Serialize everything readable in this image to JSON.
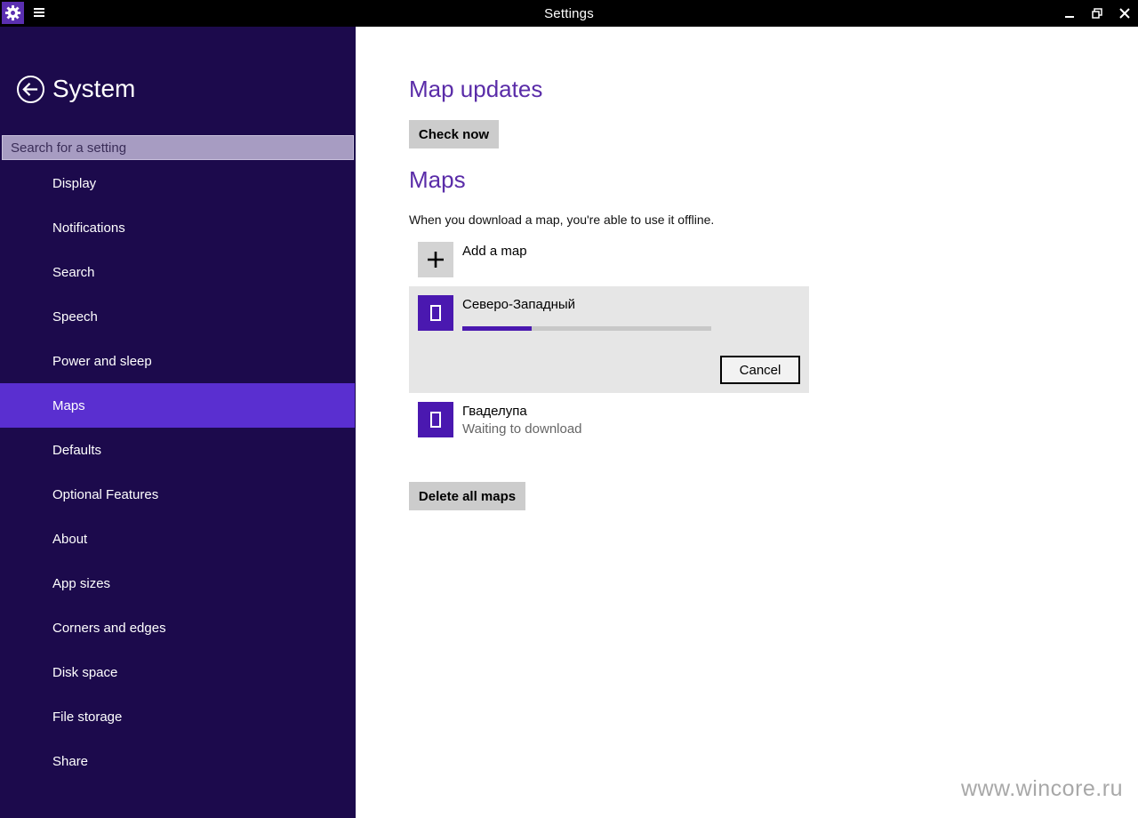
{
  "titlebar": {
    "title": "Settings",
    "icons": {
      "app": "gear-icon",
      "menu": "hamburger-icon",
      "minimize": "minimize-icon",
      "restore": "restore-icon",
      "close": "close-icon"
    }
  },
  "sidebar": {
    "title": "System",
    "back_icon": "back-arrow-icon",
    "search": {
      "placeholder": "Search for a setting",
      "value": ""
    },
    "items": [
      {
        "label": "Display",
        "active": false
      },
      {
        "label": "Notifications",
        "active": false
      },
      {
        "label": "Search",
        "active": false
      },
      {
        "label": "Speech",
        "active": false
      },
      {
        "label": "Power and sleep",
        "active": false
      },
      {
        "label": "Maps",
        "active": true
      },
      {
        "label": "Defaults",
        "active": false
      },
      {
        "label": "Optional Features",
        "active": false
      },
      {
        "label": "About",
        "active": false
      },
      {
        "label": "App sizes",
        "active": false
      },
      {
        "label": "Corners and edges",
        "active": false
      },
      {
        "label": "Disk space",
        "active": false
      },
      {
        "label": "File storage",
        "active": false
      },
      {
        "label": "Share",
        "active": false
      }
    ]
  },
  "main": {
    "map_updates": {
      "heading": "Map updates",
      "check_now_label": "Check now"
    },
    "maps": {
      "heading": "Maps",
      "description": "When you download a map, you're able to use it offline.",
      "add_map_label": "Add a map",
      "downloading": {
        "name": "Северо-Западный",
        "progress": 0.28,
        "cancel_label": "Cancel"
      },
      "queued": {
        "name": "Гваделупа",
        "status": "Waiting to download"
      },
      "delete_all_label": "Delete all maps"
    }
  },
  "watermark": "www.wincore.ru",
  "colors": {
    "accent": "#5a2fd0",
    "sidebar_bg": "#1c0a4c",
    "heading": "#5a2ca8",
    "tile": "#4a18b0"
  }
}
